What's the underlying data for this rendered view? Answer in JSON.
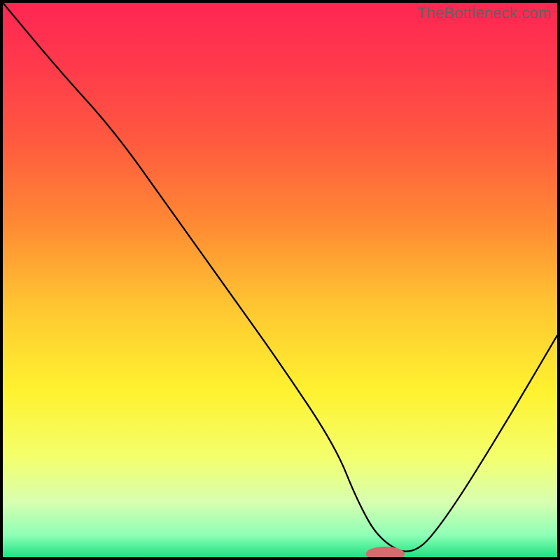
{
  "watermark": "TheBottleneck.com",
  "chart_data": {
    "type": "line",
    "title": "",
    "xlabel": "",
    "ylabel": "",
    "x_range": [
      0,
      100
    ],
    "y_range": [
      0,
      100
    ],
    "series": [
      {
        "name": "curve",
        "x": [
          0,
          10,
          20,
          30,
          40,
          50,
          60,
          64,
          68,
          74,
          80,
          90,
          100
        ],
        "y": [
          100,
          88,
          77,
          63,
          49,
          35,
          20,
          10,
          3,
          0,
          7,
          23,
          40
        ]
      }
    ],
    "marker": {
      "x": 69,
      "y": 0.6,
      "color": "#d66a6e",
      "rx": 3.5,
      "ry": 1.3
    },
    "gradient": {
      "stops": [
        {
          "offset": 0.0,
          "color": "#ff2653"
        },
        {
          "offset": 0.12,
          "color": "#ff3b4b"
        },
        {
          "offset": 0.25,
          "color": "#ff5a3f"
        },
        {
          "offset": 0.4,
          "color": "#ff8a33"
        },
        {
          "offset": 0.55,
          "color": "#ffc731"
        },
        {
          "offset": 0.7,
          "color": "#fff22f"
        },
        {
          "offset": 0.82,
          "color": "#f3ff6c"
        },
        {
          "offset": 0.9,
          "color": "#d8ffb0"
        },
        {
          "offset": 0.96,
          "color": "#8effb6"
        },
        {
          "offset": 1.0,
          "color": "#1de282"
        }
      ]
    }
  }
}
